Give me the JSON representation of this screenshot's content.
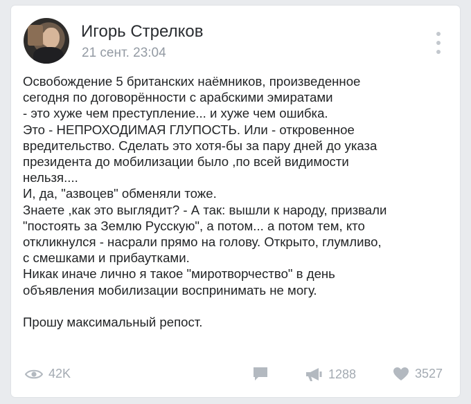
{
  "post": {
    "author": "Игорь Стрелков",
    "date": "21 сент. 23:04",
    "text": "Освобождение 5 британских наёмников, произведенное\nсегодня по договорённости с арабскими эмиратами\n- это хуже чем преступление... и хуже чем ошибка.\nЭто - НЕПРОХОДИМАЯ ГЛУПОСТЬ. Или - откровенное\nвредительство. Сделать это хотя-бы за пару дней до указа\nпрезидента до мобилизации было ,по всей видимости\nнельзя....\nИ, да, \"азвоцев\" обменяли тоже.\nЗнаете ,как это выглядит? - А так: вышли к народу, призвали\n\"постоять за Землю Русскую\", а потом... а потом тем, кто\nоткликнулся - насрали прямо на голову. Открыто, глумливо,\nс смешками и прибаутками.\nНикак иначе лично я такое \"миротворчество\" в день\nобъявления мобилизации воспринимать не могу.\n\nПрошу максимальный репост."
  },
  "footer": {
    "views": "42K",
    "reposts": "1288",
    "likes": "3527"
  },
  "icons": {
    "views": "eye-icon",
    "comment": "comment-icon",
    "share": "megaphone-icon",
    "like": "heart-icon",
    "menu": "more-vertical-icon"
  },
  "colors": {
    "background": "#e9ebee",
    "card": "#ffffff",
    "text": "#222426",
    "muted": "#a3aab2"
  }
}
